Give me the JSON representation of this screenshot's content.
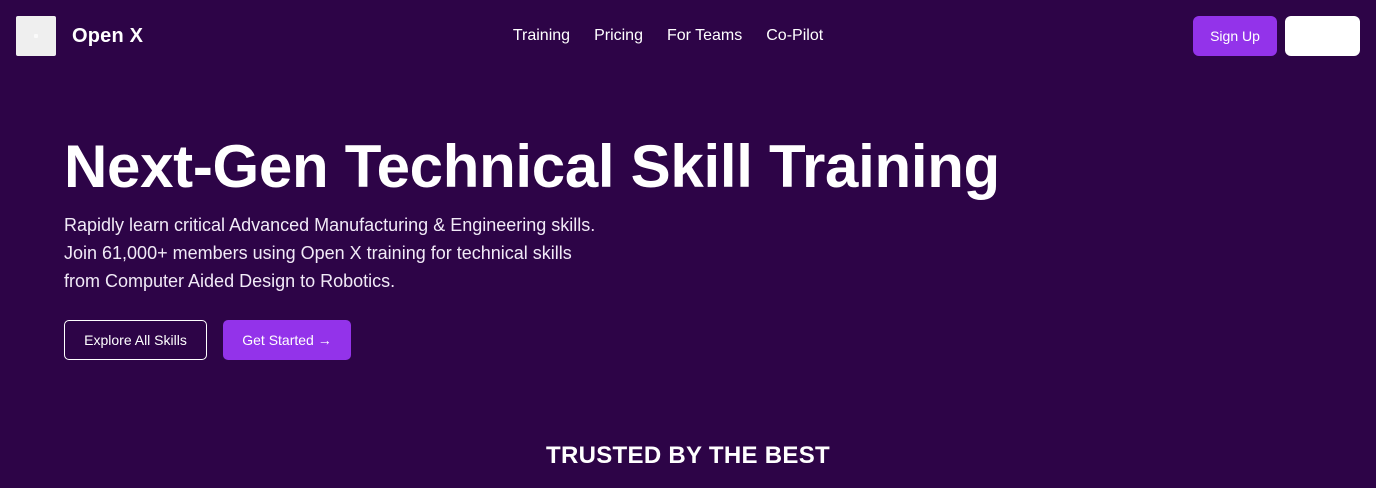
{
  "header": {
    "brand": "Open X",
    "nav": [
      "Training",
      "Pricing",
      "For Teams",
      "Co-Pilot"
    ],
    "signup_label": "Sign Up",
    "secondary_label": ""
  },
  "hero": {
    "title": "Next-Gen Technical Skill Training",
    "subtitle_lines": [
      "Rapidly learn critical Advanced Manufacturing & Engineering skills.",
      "Join 61,000+ members using Open X training for technical skills",
      "from Computer Aided Design to Robotics."
    ],
    "explore_label": "Explore All Skills",
    "start_label": "Get Started →"
  },
  "trusted": {
    "heading": "TRUSTED BY THE BEST"
  },
  "colors": {
    "background": "#2d0447",
    "accent": "#9333ea",
    "text": "#ffffff"
  },
  "icons": {
    "logo": "logo-icon"
  }
}
